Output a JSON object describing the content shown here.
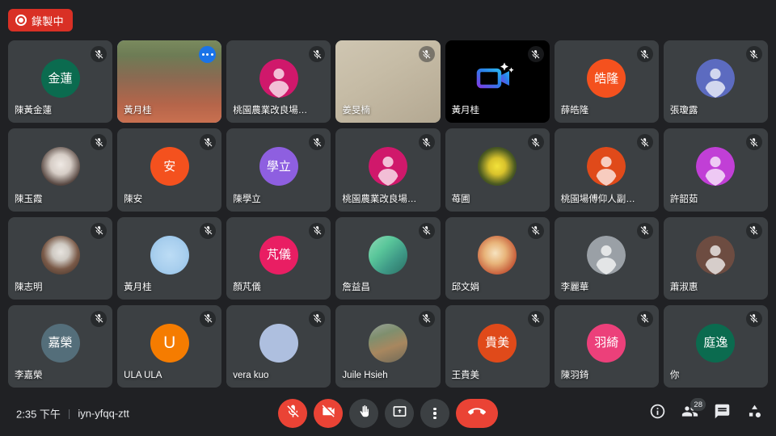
{
  "recording": {
    "label": "錄製中",
    "icon": "record-icon",
    "color": "#d93025"
  },
  "meeting": {
    "time": "2:35 下午",
    "separator": "|",
    "code": "iyn-yfqq-ztt"
  },
  "grid": {
    "columns": 7,
    "rows": 4,
    "tiles": [
      {
        "name": "陳黃金蓮",
        "kind": "initials",
        "initials": "金蓮",
        "color": "#0b6b4f",
        "muted": true
      },
      {
        "name": "黃月桂",
        "kind": "video",
        "active": true,
        "muted": false,
        "more": true
      },
      {
        "name": "桃園農業改良場教育...",
        "kind": "person",
        "color": "#d0186b",
        "muted": true
      },
      {
        "name": "姜旻楠",
        "kind": "photo-light",
        "muted": true
      },
      {
        "name": "黃月桂",
        "kind": "video-logo",
        "dark": true,
        "muted": true
      },
      {
        "name": "薛皓隆",
        "kind": "initials",
        "initials": "皓隆",
        "color": "#f4511e",
        "muted": true
      },
      {
        "name": "張瓊露",
        "kind": "person",
        "color": "#5c6bc0",
        "muted": true
      },
      {
        "name": "陳玉霞",
        "kind": "photo-portrait",
        "muted": true
      },
      {
        "name": "陳安",
        "kind": "initials",
        "initials": "安",
        "color": "#f4511e",
        "muted": true
      },
      {
        "name": "陳學立",
        "kind": "initials",
        "initials": "學立",
        "color": "#8e5fe0",
        "muted": true
      },
      {
        "name": "桃園農業改良場教育...",
        "kind": "person",
        "color": "#d0186b",
        "muted": true
      },
      {
        "name": "苺圃",
        "kind": "photo-leaf",
        "muted": true
      },
      {
        "name": "桃園場傅仰人副場長",
        "kind": "person",
        "color": "#e04a1a",
        "muted": true
      },
      {
        "name": "許韶茹",
        "kind": "person",
        "color": "#c13fd6",
        "muted": true
      },
      {
        "name": "陳志明",
        "kind": "photo-man",
        "muted": true
      },
      {
        "name": "黃月桂",
        "kind": "photo-cartoon",
        "muted": true
      },
      {
        "name": "顏芃儀",
        "kind": "initials",
        "initials": "芃儀",
        "color": "#e91e63",
        "muted": true
      },
      {
        "name": "詹益昌",
        "kind": "photo-green",
        "muted": true
      },
      {
        "name": "邱文娟",
        "kind": "photo-food",
        "muted": true
      },
      {
        "name": "李麗華",
        "kind": "person",
        "color": "#9aa0a6",
        "muted": true
      },
      {
        "name": "蕭淑惠",
        "kind": "person",
        "color": "#6d4c41",
        "muted": true
      },
      {
        "name": "李嘉榮",
        "kind": "initials",
        "initials": "嘉榮",
        "color": "#546e7a",
        "muted": true
      },
      {
        "name": "ULA ULA",
        "kind": "letter",
        "initials": "U",
        "color": "#f57c00",
        "muted": true
      },
      {
        "name": "vera kuo",
        "kind": "blank",
        "color": "#aebfdf",
        "muted": true
      },
      {
        "name": "Juile Hsieh",
        "kind": "photo-street",
        "muted": true
      },
      {
        "name": "王貴美",
        "kind": "initials",
        "initials": "貴美",
        "color": "#e04a1a",
        "muted": true
      },
      {
        "name": "陳羽錡",
        "kind": "initials",
        "initials": "羽綺",
        "color": "#ec407a",
        "muted": true
      },
      {
        "name": "你",
        "kind": "initials",
        "initials": "庭逸",
        "color": "#0b6b4f",
        "muted": true
      }
    ]
  },
  "controls": [
    {
      "id": "mic",
      "icon": "mic-off-icon",
      "label": "關閉麥克風",
      "state": "off",
      "style": "red"
    },
    {
      "id": "camera",
      "icon": "camera-off-icon",
      "label": "關閉攝影機",
      "state": "off",
      "style": "red"
    },
    {
      "id": "raise-hand",
      "icon": "raise-hand-icon",
      "label": "舉手",
      "state": "on",
      "style": "grey"
    },
    {
      "id": "present",
      "icon": "present-screen-icon",
      "label": "立即分享螢幕畫面",
      "state": "on",
      "style": "grey"
    },
    {
      "id": "more",
      "icon": "more-vertical-icon",
      "label": "更多選項",
      "state": "on",
      "style": "grey"
    },
    {
      "id": "end-call",
      "icon": "end-call-icon",
      "label": "離開通話",
      "state": "on",
      "style": "red-pill"
    }
  ],
  "right_actions": [
    {
      "id": "info",
      "icon": "info-icon",
      "label": "會議詳細資料",
      "badge": ""
    },
    {
      "id": "people",
      "icon": "people-icon",
      "label": "顯示所有參與者",
      "badge": "28"
    },
    {
      "id": "chat",
      "icon": "chat-icon",
      "label": "與所有參與者進行即時通訊",
      "badge": ""
    },
    {
      "id": "activities",
      "icon": "activities-icon",
      "label": "活動",
      "badge": ""
    }
  ]
}
